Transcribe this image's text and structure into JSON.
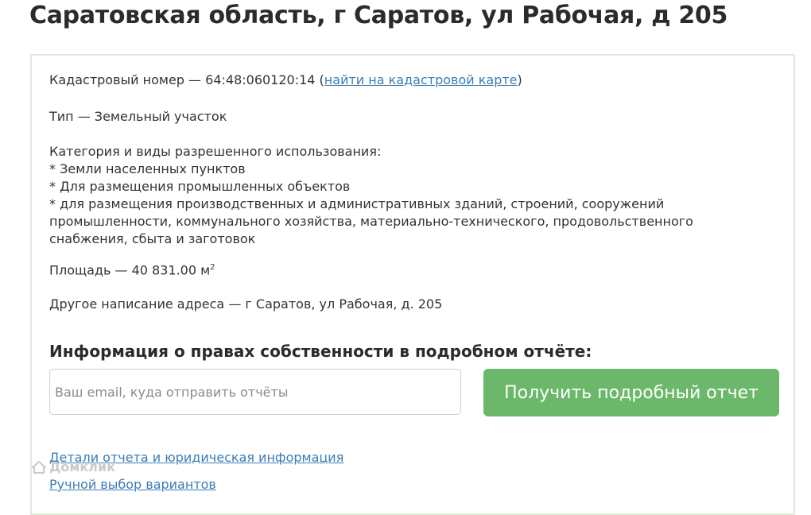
{
  "header": {
    "title": "Саратовская область, г Саратов, ул Рабочая, д 205"
  },
  "details": {
    "cadastral_prefix": "Кадастровый номер — 64:48:060120:14 (",
    "cadastral_link": "найти на кадастровой карте",
    "cadastral_suffix": ")",
    "type": "Тип — Земельный участок",
    "category_title": "Категория и виды разрешенного использования:",
    "category_items": [
      "* Земли населенных пунктов",
      "* Для размещения промышленных объектов",
      "* для размещения производственных и административных зданий, строений, сооружений",
      "промышленности, коммунального хозяйства, материально-технического, продовольственного",
      "снабжения, сбыта и заготовок"
    ],
    "area": "Площадь — 40 831.00 м",
    "area_unit_sup": "2",
    "alt_address": "Другое написание адреса — г Саратов, ул Рабочая, д. 205"
  },
  "report": {
    "title": "Информация о правах собственности в подробном отчёте:",
    "email_placeholder": "Ваш email, куда отправить отчёты",
    "button_label": "Получить подробный отчет"
  },
  "links": {
    "details": "Детали отчета и юридическая информация",
    "manual": "Ручной выбор вариантов"
  },
  "watermark": {
    "text": "Домклик",
    "icon": "house-logo-icon"
  },
  "colors": {
    "accent_green": "#6bb86b",
    "link_blue": "#3a7db5",
    "card_border": "#dfe9d8"
  }
}
